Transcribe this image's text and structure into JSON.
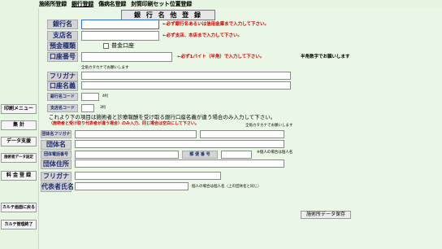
{
  "tabs": [
    "施術所登録",
    "銀行登録",
    "傷病名登録",
    "封筒印刷セット位置登録"
  ],
  "title": "銀 行 名 他 登 録",
  "fields": {
    "bank_name": "銀行名",
    "branch_name": "支店名",
    "account_type": "預金種類",
    "account_number": "口座番号",
    "furigana": "フリガナ",
    "account_holder": "口座名義",
    "bank_code": "銀行名コード",
    "branch_code": "支店名コード",
    "org_furigana": "団体名フリガナ",
    "org_name": "団体名",
    "org_phone": "団体電話番号",
    "postal": "郵 便 番 号",
    "org_address": "団体住所",
    "rep_furigana": "フリガナ",
    "rep_name": "代表者氏名"
  },
  "notes": {
    "bank_name": "←必ず銀行名あるいは信用金庫まで入力して下さい。",
    "branch_name": "←必ず支店、本店まで入力して下さい。",
    "account_type_value": "普金口座",
    "account_number": "←必ず1バイト（半角）で入力して下さい。",
    "account_number_suffix": "半角数字でお願いします",
    "furigana_hint": "全角カタカナでお願いします",
    "bank_code_digits": "4桁",
    "branch_code_digits": "3桁",
    "instruction": "これより下の項目は施術者と診療報酬を受け取る銀行口座名義が違う場合のみ入力して下さい。",
    "instruction_red": "（施術者と受け取り代表者が違う場合）のみ入力、同じ場合は空白にして下さい。",
    "org_furigana_hint": "全角カタカナでお願いします",
    "org_phone_hint": "※個人の場合は個人名",
    "rep_hint": "個人の場合は個人名（上の団体名と同じ）"
  },
  "sidebar": [
    "印刷メニュー",
    "集 計",
    "データ支援",
    "施術者データ設定",
    "料 金 登 録",
    "カルテ画面に戻る",
    "カルテ管理終了"
  ],
  "save_button": "施術所データ保存"
}
